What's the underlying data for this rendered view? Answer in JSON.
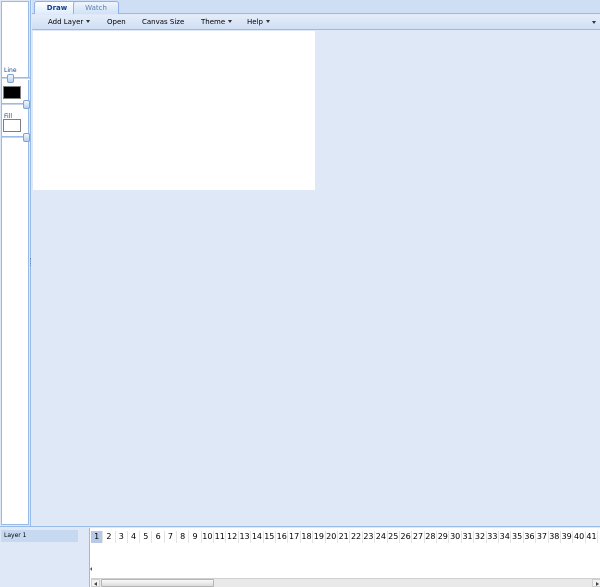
{
  "tabs": [
    {
      "label": "Draw",
      "active": true
    },
    {
      "label": "Watch",
      "active": false
    }
  ],
  "toolbar": {
    "add_layer": "Add Layer",
    "open": "Open",
    "canvas_size": "Canvas Size",
    "theme": "Theme",
    "help": "Help"
  },
  "tools": {
    "line_label": "Line",
    "fill_label": "Fill",
    "line_color": "#000000",
    "fill_color": "#ffffff"
  },
  "layers": [
    {
      "name": "Layer 1"
    }
  ],
  "frames": [
    "1",
    "2",
    "3",
    "4",
    "5",
    "6",
    "7",
    "8",
    "9",
    "10",
    "11",
    "12",
    "13",
    "14",
    "15",
    "16",
    "17",
    "18",
    "19",
    "20",
    "21",
    "22",
    "23",
    "24",
    "25",
    "26",
    "27",
    "28",
    "29",
    "30",
    "31",
    "32",
    "33",
    "34",
    "35",
    "36",
    "37",
    "38",
    "39",
    "40",
    "41"
  ],
  "selected_frame": "1",
  "colors": {
    "panel_bg": "#dfe8f6",
    "border": "#99bbe8",
    "accent_text": "#15428b",
    "selected_frame": "#b7c9e6"
  }
}
